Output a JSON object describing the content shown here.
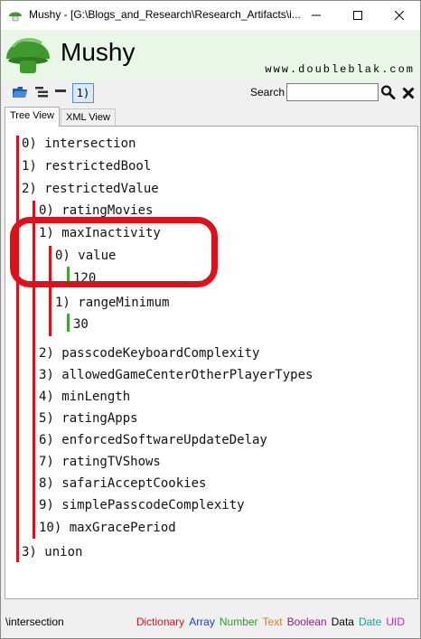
{
  "window": {
    "title": "Mushy - [G:\\Blogs_and_Research\\Research_Artifacts\\i...",
    "minimize": "—",
    "maximize": "☐",
    "close": "✕"
  },
  "banner": {
    "brand": "Mushy",
    "site": "www.doubleblak.com"
  },
  "toolbar": {
    "bracket_label": "1)",
    "search_label": "Search",
    "search_value": ""
  },
  "tabs": [
    {
      "label": "Tree View",
      "active": true
    },
    {
      "label": "XML View",
      "active": false
    }
  ],
  "tree": {
    "n0": "0)  intersection",
    "n1": "1)  restrictedBool",
    "n2": "2)  restrictedValue",
    "n2_0": "0)  ratingMovies",
    "n2_1": "1)  maxInactivity",
    "n2_1_0": "0)  value",
    "n2_1_0_v": "120",
    "n2_1_1": "1)  rangeMinimum",
    "n2_1_1_v": "30",
    "n2_2": "2)  passcodeKeyboardComplexity",
    "n2_3": "3)  allowedGameCenterOtherPlayerTypes",
    "n2_4": "4)  minLength",
    "n2_5": "5)  ratingApps",
    "n2_6": "6)  enforcedSoftwareUpdateDelay",
    "n2_7": "7)  ratingTVShows",
    "n2_8": "8)  safariAcceptCookies",
    "n2_9": "9)  simplePasscodeComplexity",
    "n2_10": "10)  maxGracePeriod",
    "n3": "3)  union"
  },
  "status": {
    "path": "\\intersection",
    "legend": [
      {
        "label": "Dictionary",
        "color": "#e0101a"
      },
      {
        "label": "Array",
        "color": "#1a3fd0"
      },
      {
        "label": "Number",
        "color": "#2e9a24"
      },
      {
        "label": "Text",
        "color": "#e07a22"
      },
      {
        "label": "Boolean",
        "color": "#9a14a8"
      },
      {
        "label": "Data",
        "color": "#000000"
      },
      {
        "label": "Date",
        "color": "#16a3a0"
      },
      {
        "label": "UID",
        "color": "#d21ad8"
      }
    ]
  }
}
